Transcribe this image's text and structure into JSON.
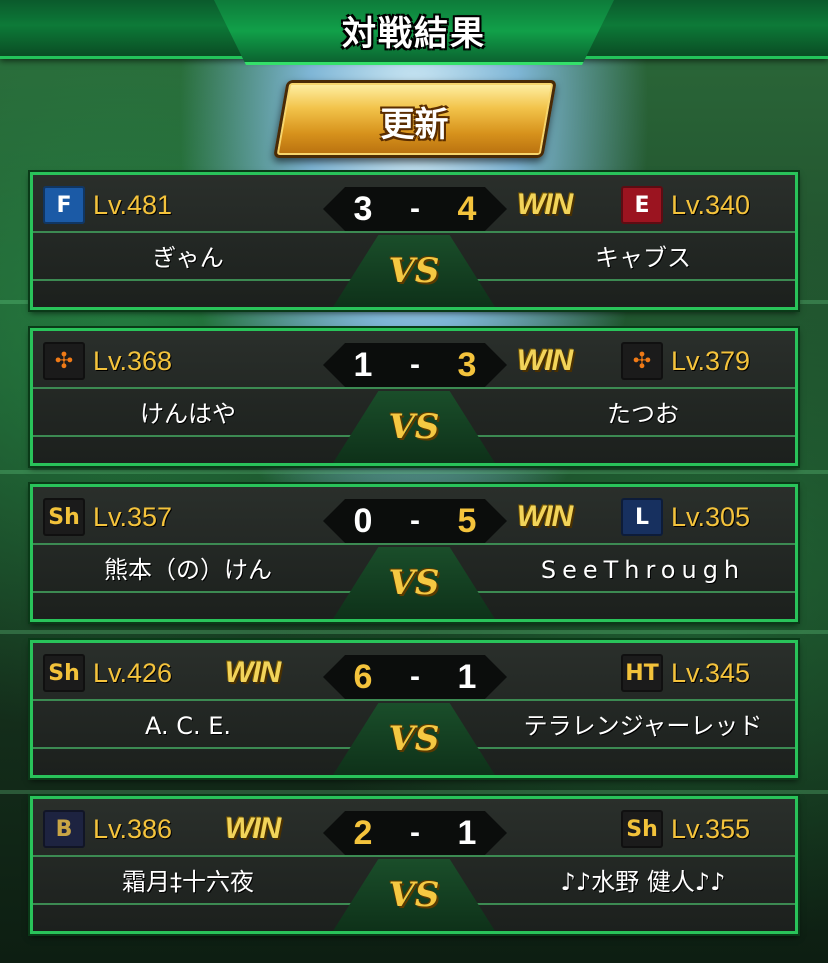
{
  "header": {
    "title": "対戦結果"
  },
  "refresh_button": {
    "label": "更新"
  },
  "colors": {
    "accent_green": "#29c35a",
    "gold": "#f4c33c",
    "win_gold": "#f2d45a",
    "score_white": "#ffffff",
    "score_gold": "#f4c33c"
  },
  "common": {
    "win_label": "WIN",
    "vs_label": "VS",
    "dash": "-"
  },
  "matches": [
    {
      "left": {
        "logo_icon": "f-hexagon-logo-icon",
        "logo_text": "F",
        "logo_bg": "#1b5aa6",
        "logo_fg": "#ffffff",
        "level": "Lv.481",
        "name": "ぎゃん",
        "score": "3"
      },
      "right": {
        "logo_icon": "eagle-e-logo-icon",
        "logo_text": "E",
        "logo_bg": "#9b1420",
        "logo_fg": "#ffffff",
        "level": "Lv.340",
        "name": "キャブス",
        "score": "4"
      },
      "winner": "right"
    },
    {
      "left": {
        "logo_icon": "yg-orange-logo-icon",
        "logo_text": "✣",
        "logo_bg": "#1b1b1b",
        "logo_fg": "#f07a16",
        "level": "Lv.368",
        "name": "けんはや",
        "score": "1"
      },
      "right": {
        "logo_icon": "yg-orange-logo-icon",
        "logo_text": "✣",
        "logo_bg": "#1b1b1b",
        "logo_fg": "#f07a16",
        "level": "Lv.379",
        "name": "たつお",
        "score": "3"
      },
      "winner": "right"
    },
    {
      "left": {
        "logo_icon": "sh-logo-icon",
        "logo_text": "Sh",
        "logo_bg": "#1b1b1b",
        "logo_fg": "#f2c23a",
        "level": "Lv.357",
        "name": "熊本（の）けん",
        "score": "0"
      },
      "right": {
        "logo_icon": "l-logo-icon",
        "logo_text": "L",
        "logo_bg": "#17305f",
        "logo_fg": "#ffffff",
        "level": "Lv.305",
        "name": "SeeThrough",
        "score": "5"
      },
      "winner": "right"
    },
    {
      "left": {
        "logo_icon": "sh-logo-icon",
        "logo_text": "Sh",
        "logo_bg": "#1b1b1b",
        "logo_fg": "#f2c23a",
        "level": "Lv.426",
        "name": "A. C. E.",
        "score": "6"
      },
      "right": {
        "logo_icon": "ht-logo-icon",
        "logo_text": "HT",
        "logo_bg": "#1b1b1b",
        "logo_fg": "#f2c23a",
        "level": "Lv.345",
        "name": "テラレンジャーレッド",
        "score": "1"
      },
      "winner": "left"
    },
    {
      "left": {
        "logo_icon": "b-logo-icon",
        "logo_text": "B",
        "logo_bg": "#1d2340",
        "logo_fg": "#c9a545",
        "level": "Lv.386",
        "name": "霜月‡十六夜",
        "score": "2"
      },
      "right": {
        "logo_icon": "sh-logo-icon",
        "logo_text": "Sh",
        "logo_bg": "#1b1b1b",
        "logo_fg": "#f2c23a",
        "level": "Lv.355",
        "name": "♪♪水野 健人♪♪",
        "score": "1"
      },
      "winner": "left"
    }
  ]
}
